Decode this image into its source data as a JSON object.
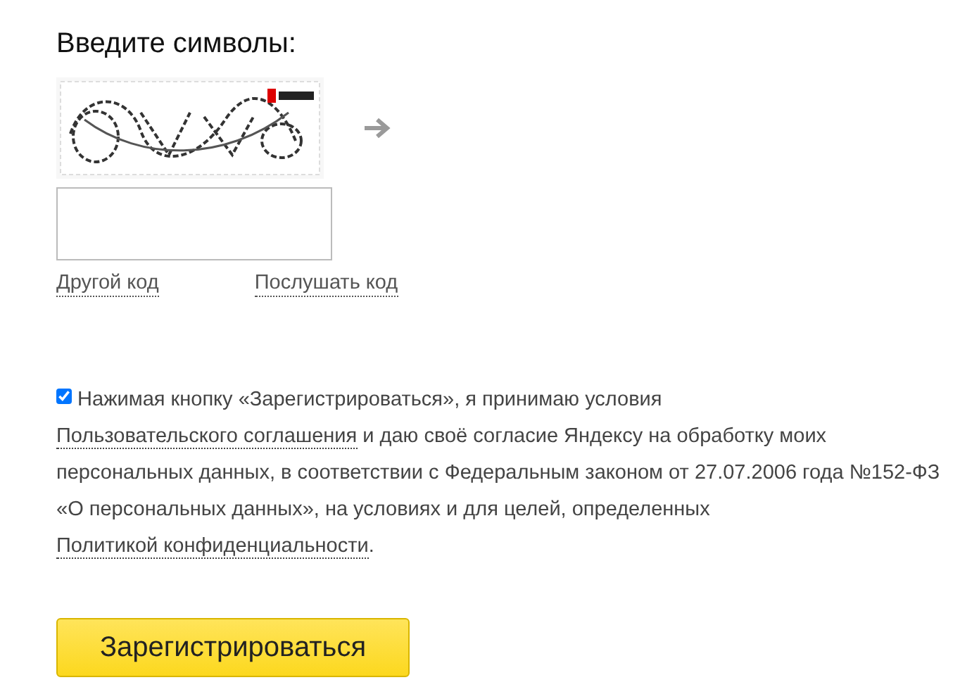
{
  "title": "Введите символы:",
  "captcha_links": [
    "Другой код",
    "Послушать код"
  ],
  "consent": {
    "checked": true,
    "parts": [
      {
        "kind": "text",
        "text": "Нажимая кнопку «Зарегистрироваться», я принимаю условия "
      },
      {
        "kind": "link",
        "text": "Пользовательского соглашения"
      },
      {
        "kind": "text",
        "text": " и даю своё согласие Яндексу на обработку моих персональных данных, в соответствии с Федеральным законом от 27.07.2006 года №152-ФЗ"
      },
      {
        "kind": "break"
      },
      {
        "kind": "text",
        "text": "«О персональных данных», на условиях и для целей, определенных "
      },
      {
        "kind": "link",
        "text": "Политикой конфиденциальности"
      },
      {
        "kind": "text",
        "text": "."
      }
    ]
  },
  "submit_button": "Зарегистрироваться"
}
